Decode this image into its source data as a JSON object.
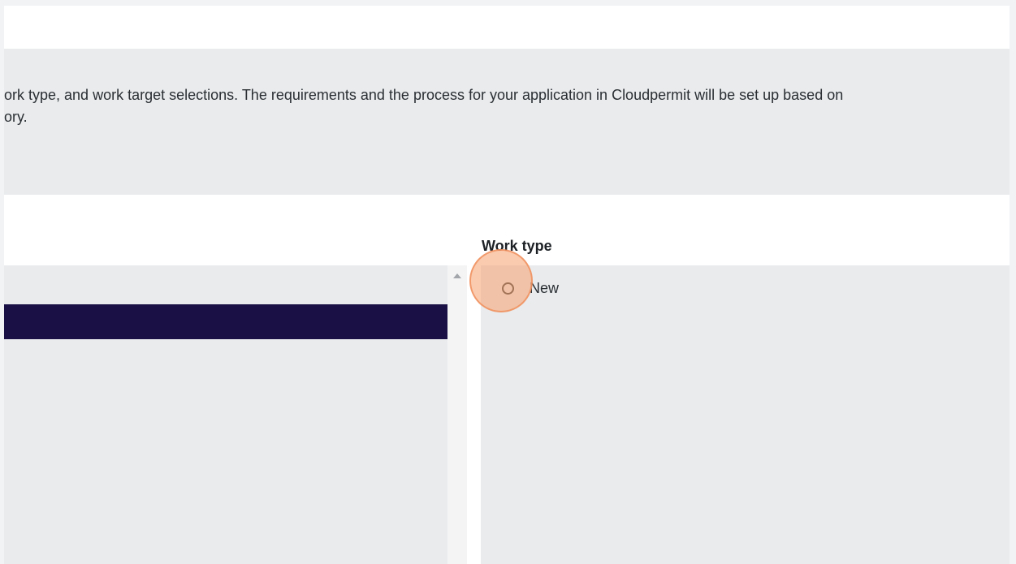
{
  "info": {
    "line1": "ork type, and work target selections. The requirements and the process for your application in Cloudpermit will be set up based on",
    "line2": "ory."
  },
  "work_type": {
    "label": "Work type",
    "options": [
      {
        "label": "New",
        "selected": false
      }
    ]
  },
  "colors": {
    "selected_row": "#1a1045",
    "panel_bg": "#e9ebed",
    "click_highlight": "#f7a16e"
  }
}
